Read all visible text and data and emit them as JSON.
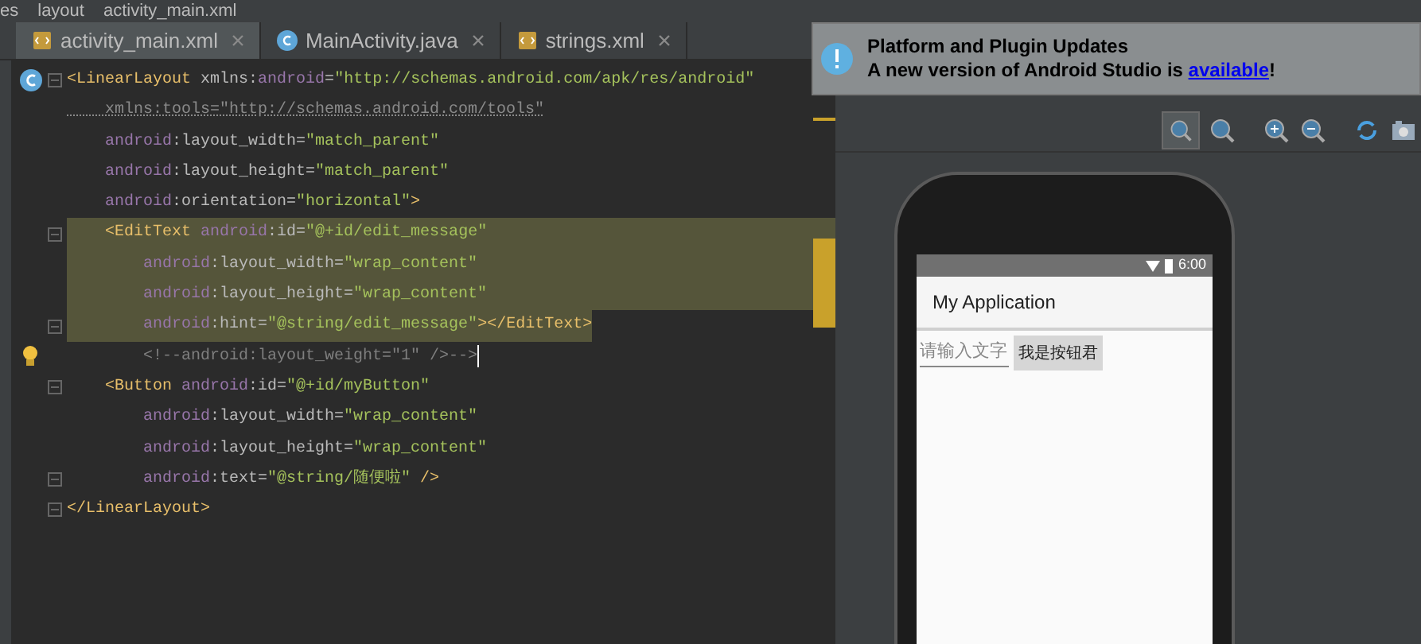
{
  "breadcrumb": [
    "es",
    "layout",
    "activity_main.xml"
  ],
  "tabs": [
    {
      "label": "activity_main.xml",
      "kind": "xml",
      "selected": true
    },
    {
      "label": "MainActivity.java",
      "kind": "class",
      "selected": false
    },
    {
      "label": "strings.xml",
      "kind": "xml",
      "selected": false
    }
  ],
  "code_lines": [
    {
      "kind": "class",
      "fold": true,
      "selected": false,
      "tokens": [
        {
          "kind": "tag",
          "text": "<LinearLayout "
        },
        {
          "kind": "attr",
          "text": "xmlns:"
        },
        {
          "kind": "ns",
          "text": "android"
        },
        {
          "kind": "attr",
          "text": "="
        },
        {
          "kind": "value",
          "text": "\"http://schemas.android.com/apk/res/android\""
        }
      ]
    },
    {
      "fold": false,
      "selected": false,
      "tokens": [
        {
          "kind": "dim",
          "text": "    xmlns:tools=\"http://schemas.android.com/tools\""
        }
      ]
    },
    {
      "fold": false,
      "selected": false,
      "tokens": [
        {
          "kind": "ns",
          "text": "    android"
        },
        {
          "kind": "attr",
          "text": ":layout_width="
        },
        {
          "kind": "value",
          "text": "\"match_parent\""
        }
      ]
    },
    {
      "fold": false,
      "selected": false,
      "tokens": [
        {
          "kind": "ns",
          "text": "    android"
        },
        {
          "kind": "attr",
          "text": ":layout_height="
        },
        {
          "kind": "value",
          "text": "\"match_parent\""
        }
      ]
    },
    {
      "fold": false,
      "selected": false,
      "tokens": [
        {
          "kind": "ns",
          "text": "    android"
        },
        {
          "kind": "attr",
          "text": ":orientation="
        },
        {
          "kind": "value",
          "text": "\"horizontal\""
        },
        {
          "kind": "tag",
          "text": ">"
        }
      ]
    },
    {
      "fold": true,
      "selected": true,
      "tokens": [
        {
          "kind": "tag",
          "text": "    <EditText "
        },
        {
          "kind": "ns",
          "text": "android"
        },
        {
          "kind": "attr",
          "text": ":id="
        },
        {
          "kind": "value",
          "text": "\"@+id/edit_message\""
        }
      ]
    },
    {
      "fold": false,
      "selected": true,
      "tokens": [
        {
          "kind": "ns",
          "text": "        android"
        },
        {
          "kind": "attr",
          "text": ":layout_width="
        },
        {
          "kind": "value",
          "text": "\"wrap_content\""
        }
      ]
    },
    {
      "fold": false,
      "selected": true,
      "tokens": [
        {
          "kind": "ns",
          "text": "        android"
        },
        {
          "kind": "attr",
          "text": ":layout_height="
        },
        {
          "kind": "value",
          "text": "\"wrap_content\""
        }
      ]
    },
    {
      "fold": true,
      "selected": true,
      "tokens": [
        {
          "kind": "ns",
          "text": "        android"
        },
        {
          "kind": "attr",
          "text": ":hint="
        },
        {
          "kind": "value",
          "text": "\"@string/edit_message\""
        },
        {
          "kind": "tag",
          "text": "></EditText>"
        }
      ]
    },
    {
      "kind": "bulb",
      "fold": false,
      "selected": false,
      "caret": true,
      "tokens": [
        {
          "kind": "comment",
          "text": "        <!--android:layout_weight=\"1\" />-->"
        }
      ]
    },
    {
      "fold": true,
      "selected": false,
      "tokens": [
        {
          "kind": "tag",
          "text": "    <Button "
        },
        {
          "kind": "ns",
          "text": "android"
        },
        {
          "kind": "attr",
          "text": ":id="
        },
        {
          "kind": "value",
          "text": "\"@+id/myButton\""
        }
      ]
    },
    {
      "fold": false,
      "selected": false,
      "tokens": [
        {
          "kind": "ns",
          "text": "        android"
        },
        {
          "kind": "attr",
          "text": ":layout_width="
        },
        {
          "kind": "value",
          "text": "\"wrap_content\""
        }
      ]
    },
    {
      "fold": false,
      "selected": false,
      "tokens": [
        {
          "kind": "ns",
          "text": "        android"
        },
        {
          "kind": "attr",
          "text": ":layout_height="
        },
        {
          "kind": "value",
          "text": "\"wrap_content\""
        }
      ]
    },
    {
      "fold": true,
      "selected": false,
      "tokens": [
        {
          "kind": "ns",
          "text": "        android"
        },
        {
          "kind": "attr",
          "text": ":text="
        },
        {
          "kind": "value",
          "text": "\"@string/随便啦\""
        },
        {
          "kind": "tag",
          "text": " />"
        }
      ]
    },
    {
      "fold": true,
      "selected": false,
      "tokens": [
        {
          "kind": "tag",
          "text": "</LinearLayout>"
        }
      ]
    }
  ],
  "notification": {
    "title": "Platform and Plugin Updates",
    "text_before": "A new version of Android Studio is ",
    "link": "available",
    "text_after": "!"
  },
  "preview": {
    "status_time": "6:00",
    "app_title": "My Application",
    "edit_hint": "请输入文字",
    "button_label": "我是按钮君"
  }
}
